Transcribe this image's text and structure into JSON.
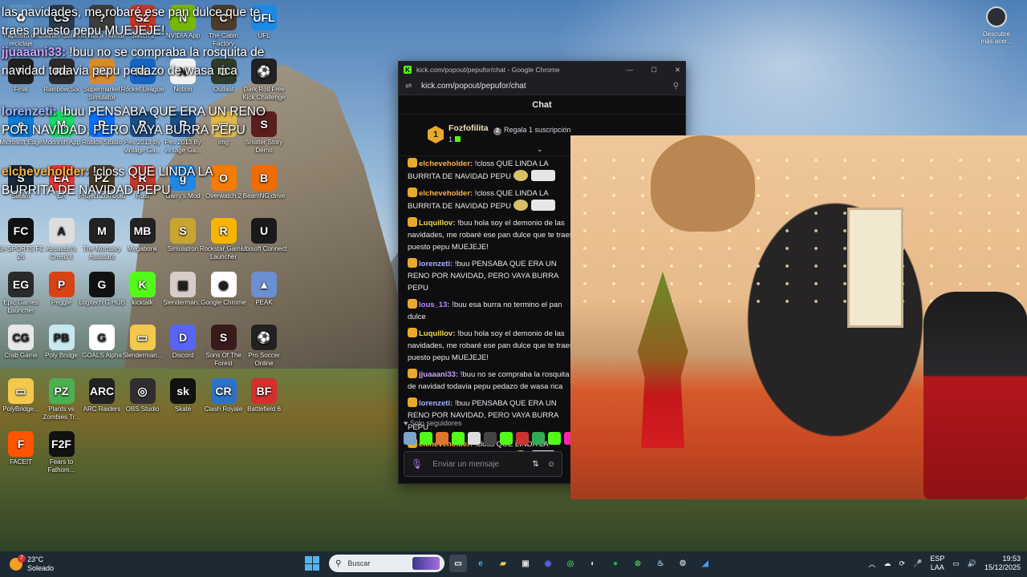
{
  "overlay_chat": [
    {
      "user": "",
      "text": "las navidades, me robaré ese pan dulce que te traes puesto pepu MUEJEJE!"
    },
    {
      "user": "jjuaaani33:",
      "text": " !buu no se compraba la rosquita de navidad todavia pepu pedazo de wasa rica"
    },
    {
      "user": "lorenzeti:",
      "text": " !buu PENSABA QUE ERA UN RENO POR NAVIDAD, PERO VAYA BURRA PEPU"
    },
    {
      "user": "elcheveholder:",
      "text": " !closs QUE LINDA LA BURRITA DE NAVIDAD PEPU"
    }
  ],
  "desktop_icons": [
    {
      "label": "Papelera de reciclaje",
      "color": "#5a8fc2",
      "glyph": "♻"
    },
    {
      "label": "Counter-Strike 2",
      "color": "#2b3a4a",
      "glyph": "CS"
    },
    {
      "label": "I'm Not a Human",
      "color": "#3c3c3c",
      "glyph": "?"
    },
    {
      "label": "Switch 2",
      "color": "#c0392b",
      "glyph": "S2"
    },
    {
      "label": "NVIDIA App",
      "color": "#76b900",
      "glyph": "N"
    },
    {
      "label": "The Cabin Factory",
      "color": "#4a3b2b",
      "glyph": "C"
    },
    {
      "label": "UFL",
      "color": "#1e88e5",
      "glyph": "UFL"
    },
    {
      "label": "Final",
      "color": "#202020",
      "glyph": "F"
    },
    {
      "label": "Rainbow Six",
      "color": "#2b2b2b",
      "glyph": "R6"
    },
    {
      "label": "Supermarket Simulator",
      "color": "#d98b2b",
      "glyph": "SM"
    },
    {
      "label": "Rocket League",
      "color": "#1565c0",
      "glyph": "RL"
    },
    {
      "label": "Notion",
      "color": "#f0f0f0",
      "glyph": "N"
    },
    {
      "label": "Outlast",
      "color": "#2e3b2a",
      "glyph": "O"
    },
    {
      "label": "Dark Roll Free Kick Challenge",
      "color": "#222",
      "glyph": "⚽"
    },
    {
      "label": "Microsoft Edge",
      "color": "#0f7bd5",
      "glyph": "e"
    },
    {
      "label": "Modrinth App",
      "color": "#1bd96a",
      "glyph": "M"
    },
    {
      "label": "Roblox Studio",
      "color": "#0c6ff5",
      "glyph": "R"
    },
    {
      "label": "Pes 2013 By vintage Ga...",
      "color": "#1d4e89",
      "glyph": "P"
    },
    {
      "label": "Pes 2013 By vintage Ga...",
      "color": "#1d4e89",
      "glyph": "P"
    },
    {
      "label": "img",
      "color": "#e0b84a",
      "glyph": "▭"
    },
    {
      "label": "Shutter Story Demo",
      "color": "#5a1e1e",
      "glyph": "S"
    },
    {
      "label": "Steam",
      "color": "#1b2838",
      "glyph": "S"
    },
    {
      "label": "EA",
      "color": "#e53935",
      "glyph": "EA"
    },
    {
      "label": "Project Zomboid",
      "color": "#4b3a2a",
      "glyph": "PZ"
    },
    {
      "label": "Rust",
      "color": "#c0392b",
      "glyph": "R"
    },
    {
      "label": "Garry's Mod",
      "color": "#1e88e5",
      "glyph": "g"
    },
    {
      "label": "Overwatch 2",
      "color": "#f57c00",
      "glyph": "O"
    },
    {
      "label": "BeamNG.drive",
      "color": "#ef6c00",
      "glyph": "B"
    },
    {
      "label": "EA SPORTS FC 26",
      "color": "#111",
      "glyph": "FC"
    },
    {
      "label": "Assassin's Creed II",
      "color": "#ddd",
      "glyph": "A"
    },
    {
      "label": "The Mortuary Assistant",
      "color": "#222",
      "glyph": "M"
    },
    {
      "label": "Megabonk",
      "color": "#222",
      "glyph": "MB"
    },
    {
      "label": "Simulatron",
      "color": "#c8a530",
      "glyph": "S"
    },
    {
      "label": "Rockstar Games Launcher",
      "color": "#f7b500",
      "glyph": "R"
    },
    {
      "label": "Ubisoft Connect",
      "color": "#1a1a1a",
      "glyph": "U"
    },
    {
      "label": "Epic Games Launcher",
      "color": "#2a2a2a",
      "glyph": "EG"
    },
    {
      "label": "Peggle",
      "color": "#d84315",
      "glyph": "P"
    },
    {
      "label": "Logitech G HUB",
      "color": "#111",
      "glyph": "G"
    },
    {
      "label": "kicktalk",
      "color": "#53fc18",
      "glyph": "K"
    },
    {
      "label": "Slenderman...",
      "color": "#d7ccc8",
      "glyph": "▤"
    },
    {
      "label": "Google Chrome",
      "color": "#fff",
      "glyph": "◉"
    },
    {
      "label": "PEAK",
      "color": "#6a8fd3",
      "glyph": "▲"
    },
    {
      "label": "Crab Game",
      "color": "#e8e8e8",
      "glyph": "CG"
    },
    {
      "label": "Poly Bridge",
      "color": "#c7e8f0",
      "glyph": "PB"
    },
    {
      "label": "GOALS Alpha",
      "color": "#fff",
      "glyph": "G"
    },
    {
      "label": "Slenderman...",
      "color": "#f2c94c",
      "glyph": "▭"
    },
    {
      "label": "Discord",
      "color": "#5865f2",
      "glyph": "D"
    },
    {
      "label": "Sons Of The Forest",
      "color": "#3a1b1b",
      "glyph": "S"
    },
    {
      "label": "Pro Soccer Online",
      "color": "#222",
      "glyph": "⚽"
    },
    {
      "label": "PolyBridge...",
      "color": "#f2c94c",
      "glyph": "▭"
    },
    {
      "label": "Plants vs Zombies Tr...",
      "color": "#4caf50",
      "glyph": "PZ"
    },
    {
      "label": "ARC Raiders",
      "color": "#222",
      "glyph": "ARC"
    },
    {
      "label": "OBS Studio",
      "color": "#302e31",
      "glyph": "◎"
    },
    {
      "label": "Skate",
      "color": "#111",
      "glyph": "sk"
    },
    {
      "label": "Clash Royale",
      "color": "#2d72c8",
      "glyph": "CR"
    },
    {
      "label": "Battlefield 6",
      "color": "#d32f2f",
      "glyph": "BF"
    },
    {
      "label": "FACEIT",
      "color": "#ff5500",
      "glyph": "F"
    },
    {
      "label": "Fears to Fathom...",
      "color": "#111",
      "glyph": "F2F"
    }
  ],
  "discover": {
    "label": "Descubre más acer..."
  },
  "chrome": {
    "title": "kick.com/popout/pepufor/chat - Google Chrome",
    "url": "kick.com/popout/pepufor/chat",
    "header": "Chat",
    "pinned_user": "Fozfofilita",
    "pinned_count": "1",
    "pinned_badge": "1",
    "gift_text": "Regala 1 suscripción",
    "messages": [
      {
        "user": "elcheveholder:",
        "color": "#f6b04b",
        "text": " !closs QUE LINDA LA BURRITA DE NAVIDAD PEPU"
      },
      {
        "user": "elcheveholder:",
        "color": "#f6b04b",
        "text": " !closs QUE LINDA LA BURRITA DE NAVIDAD PEPU"
      },
      {
        "user": "Luquillov:",
        "color": "#f1d94a",
        "text": " !buu hola soy el demonio de las navidades, me robaré ese pan dulce que te traes puesto pepu MUEJEJE!"
      },
      {
        "user": "lorenzeti:",
        "color": "#9fb6ff",
        "text": " !buu PENSABA QUE ERA UN RENO POR NAVIDAD, PERO VAYA BURRA PEPU"
      },
      {
        "user": "lous_13:",
        "color": "#b58cff",
        "text": " !buu esa burra no termino el pan dulce"
      },
      {
        "user": "Luquillov:",
        "color": "#f1d94a",
        "text": " !buu hola soy el demonio de las navidades, me robaré ese pan dulce que te traes puesto pepu MUEJEJE!"
      },
      {
        "user": "jjuaaani33:",
        "color": "#c9a2ff",
        "text": " !buu no se compraba la rosquita de navidad todavia pepu pedazo de wasa rica"
      },
      {
        "user": "lorenzeti:",
        "color": "#9fb6ff",
        "text": " !buu PENSABA QUE ERA UN RENO POR NAVIDAD, PERO VAYA BURRA PEPU"
      },
      {
        "user": "elcheveholder:",
        "color": "#f6b04b",
        "text": " !closs QUE LINDA LA BURRITA DE NAVIDAD PEPU"
      }
    ],
    "followers_only": "Solo seguidores",
    "input_placeholder": "Enviar un mensaje"
  },
  "taskbar": {
    "temperature": "23°C",
    "weather": "Soleado",
    "weather_badge": "7",
    "search_placeholder": "Buscar",
    "lang_top": "ESP",
    "lang_bottom": "LAA",
    "time": "19:53",
    "date": "15/12/2025"
  },
  "colors": {
    "kick_green": "#53fc18",
    "taskbar": "#1d2a34",
    "chat_bg": "#0e0e10"
  }
}
